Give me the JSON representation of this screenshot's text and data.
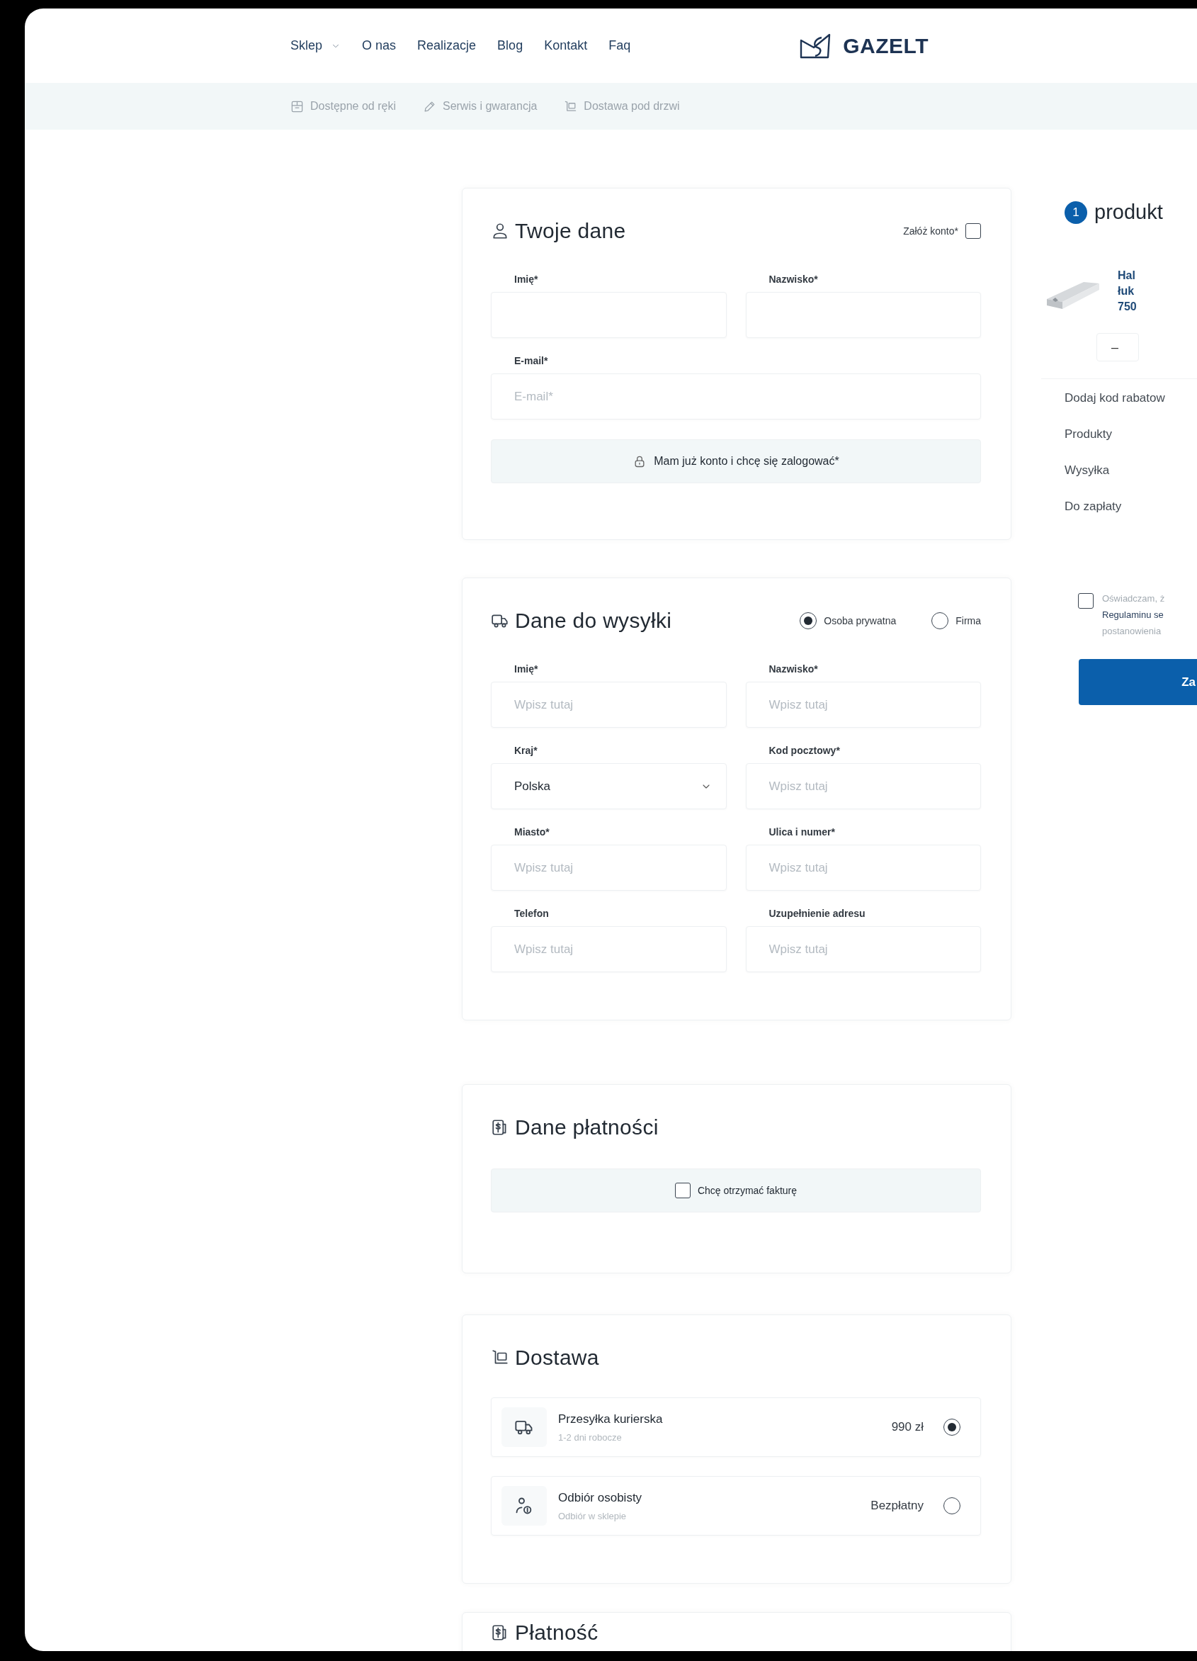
{
  "nav": {
    "items": [
      {
        "label": "Sklep",
        "dropdown": true
      },
      {
        "label": "O nas",
        "dropdown": false
      },
      {
        "label": "Realizacje",
        "dropdown": false
      },
      {
        "label": "Blog",
        "dropdown": false
      },
      {
        "label": "Kontakt",
        "dropdown": false
      },
      {
        "label": "Faq",
        "dropdown": false
      }
    ],
    "logo": "GAZELT"
  },
  "features": [
    "Dostępne od ręki",
    "Serwis i gwarancja",
    "Dostawa pod drzwi"
  ],
  "customer": {
    "title": "Twoje dane",
    "create_account": {
      "label": "Załóż konto*",
      "checked": false
    },
    "fields": [
      {
        "label": "Imię*"
      },
      {
        "label": "Nazwisko*"
      },
      {
        "label": "E-mail*",
        "placeholder": "E-mail*"
      }
    ],
    "login_button": "Mam już konto i chcę się zalogować*"
  },
  "shipping": {
    "title": "Dane do wysyłki",
    "customer_types": [
      {
        "label": "Osoba prywatna",
        "selected": true
      },
      {
        "label": "Firma",
        "selected": false
      }
    ],
    "fields": [
      {
        "kind": "text",
        "label": "Imię*",
        "placeholder": "Wpisz tutaj"
      },
      {
        "kind": "text",
        "label": "Nazwisko*",
        "placeholder": "Wpisz tutaj"
      },
      {
        "kind": "select",
        "label": "Kraj*",
        "value": "Polska"
      },
      {
        "kind": "text",
        "label": "Kod pocztowy*",
        "placeholder": "Wpisz tutaj"
      },
      {
        "kind": "text",
        "label": "Miasto*",
        "placeholder": "Wpisz tutaj"
      },
      {
        "kind": "text",
        "label": "Ulica i numer*",
        "placeholder": "Wpisz tutaj"
      },
      {
        "kind": "text",
        "label": "Telefon",
        "placeholder": "Wpisz tutaj"
      },
      {
        "kind": "text",
        "label": "Uzupełnienie adresu",
        "placeholder": "Wpisz tutaj"
      }
    ]
  },
  "payment_data": {
    "title": "Dane płatności",
    "invoice": {
      "label": "Chcę otrzymać fakturę",
      "checked": false
    }
  },
  "delivery": {
    "title": "Dostawa",
    "options": [
      {
        "name": "Przesyłka kurierska",
        "note": "1-2 dni robocze",
        "price": "990 zł",
        "selected": true
      },
      {
        "name": "Odbiór osobisty",
        "note": "Odbiór w sklepie",
        "price": "Bezpłatny",
        "selected": false
      }
    ]
  },
  "payment": {
    "title": "Płatność"
  },
  "summary": {
    "step": "1",
    "title": "produkt",
    "product": {
      "name_lines": [
        "Hal",
        "łuk",
        "750"
      ],
      "quantity_minus": "–"
    },
    "rows": [
      "Dodaj kod rabatow",
      "Produkty",
      "Wysyłka",
      "Do zapłaty"
    ],
    "consent": {
      "checked": false,
      "lines": [
        "Oświadczam, ż",
        "Regulaminu se",
        "postanowienia"
      ]
    },
    "submit": "Za"
  }
}
